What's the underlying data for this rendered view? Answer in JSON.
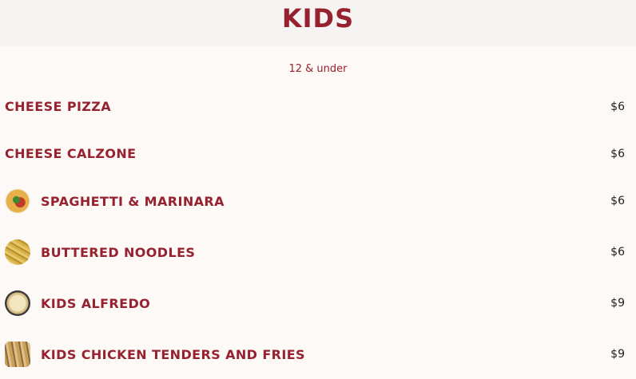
{
  "header": {
    "title": "KIDS"
  },
  "subtitle": "12 & under",
  "items": [
    {
      "name": "CHEESE PIZZA",
      "price": "$6",
      "icon": null
    },
    {
      "name": "CHEESE CALZONE",
      "price": "$6",
      "icon": null
    },
    {
      "name": "SPAGHETTI & MARINARA",
      "price": "$6",
      "icon": "spaghetti-photo-icon"
    },
    {
      "name": "BUTTERED NOODLES",
      "price": "$6",
      "icon": "noodles-photo-icon"
    },
    {
      "name": "KIDS ALFREDO",
      "price": "$9",
      "icon": "alfredo-photo-icon"
    },
    {
      "name": "KIDS CHICKEN TENDERS AND FRIES",
      "price": "$9",
      "icon": "tenders-photo-icon"
    }
  ],
  "colors": {
    "accent": "#97222f",
    "header_bg": "#f5f4f3",
    "page_bg": "#fdf9f6"
  }
}
